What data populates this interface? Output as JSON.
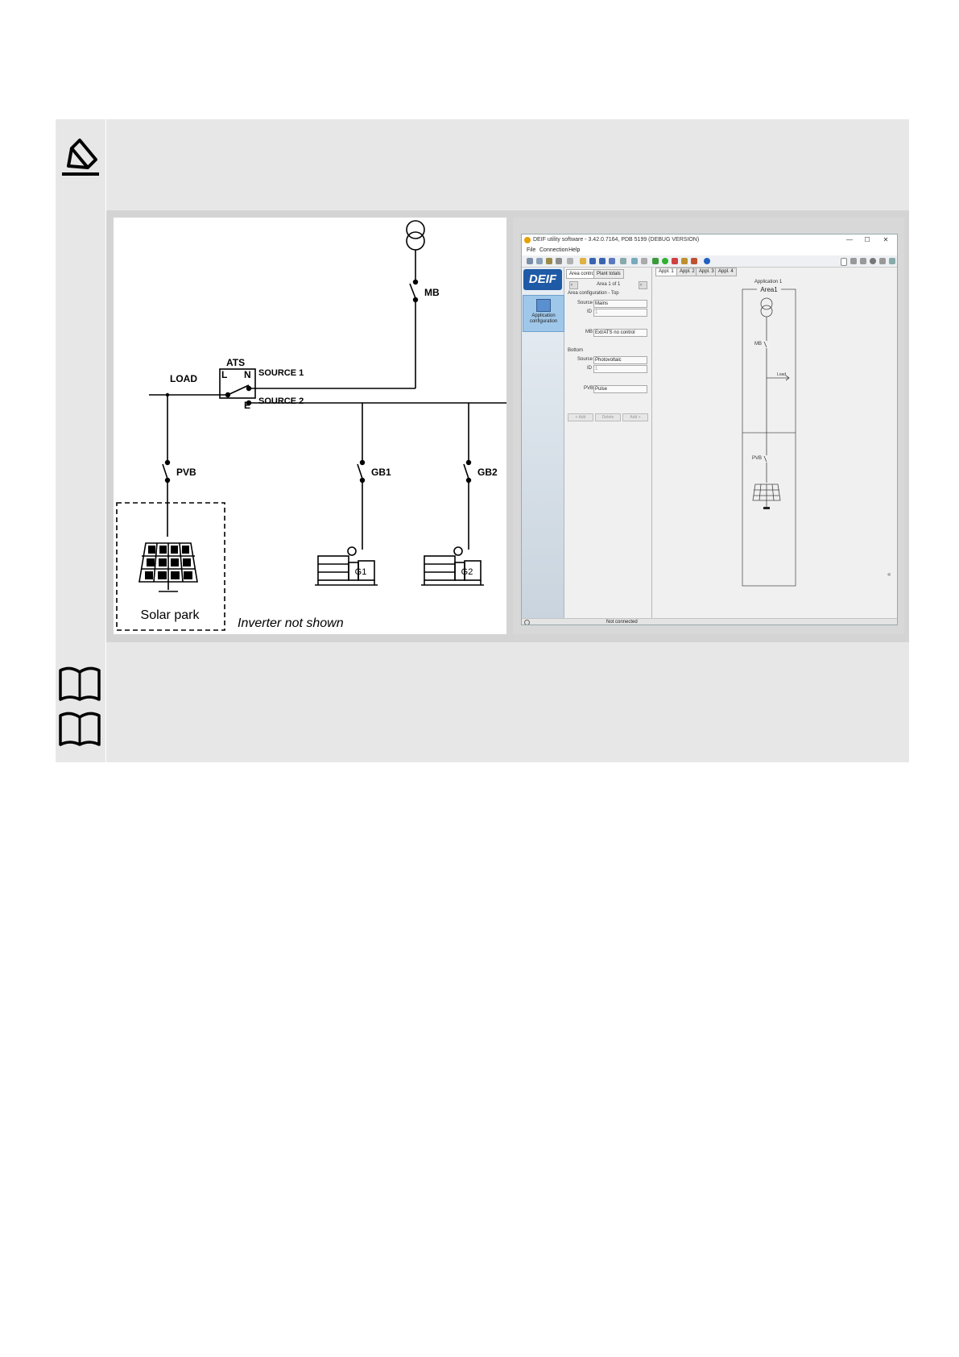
{
  "diagram": {
    "labels": {
      "mb": "MB",
      "ats": "ATS",
      "l": "L",
      "n": "N",
      "e": "E",
      "source1": "SOURCE 1",
      "source2": "SOURCE 2",
      "load": "LOAD",
      "pvb": "PVB",
      "gb1": "GB1",
      "gb2": "GB2",
      "g1": "G1",
      "g2": "G2",
      "solar_park": "Solar park",
      "inverter_note": "Inverter not shown"
    }
  },
  "software": {
    "window_title": "DEIF utility software - 3.42.0.7164, PDB 5199 (DEBUG VERSION)",
    "window_controls": [
      "—",
      "☐",
      "✕"
    ],
    "menu": [
      "File",
      "Connection",
      "Help"
    ],
    "logo": "DEIF",
    "nav_item": "Application configuration",
    "panel": {
      "tabs": [
        "Area control",
        "Plant totals"
      ],
      "area_nav": "Area 1 of 1",
      "top_section": "Area configuration - Top",
      "top_source_label": "Source",
      "top_source_value": "Mains",
      "top_id_label": "ID",
      "top_id_value": "1",
      "mb_label": "MB",
      "mb_value": "Ext/ATS no control",
      "bottom_section": "Bottom",
      "bottom_source_label": "Source",
      "bottom_source_value": "Photovoltaic",
      "bottom_id_label": "ID",
      "bottom_id_value": "1",
      "pvb_label": "PVB",
      "pvb_value": "Pulse",
      "buttons": [
        "+ Add",
        "Delete",
        "Add +"
      ]
    },
    "canvas": {
      "tabs": [
        "Appl. 1",
        "Appl. 2",
        "Appl. 3",
        "Appl. 4"
      ],
      "application_title": "Application 1",
      "area_title": "Area1",
      "mb": "MB",
      "load": "Load",
      "pvb": "PVB",
      "collapse": "«"
    },
    "status": "Not connected"
  },
  "icons": [
    "note-pencil-icon",
    "book-reference-icon"
  ]
}
